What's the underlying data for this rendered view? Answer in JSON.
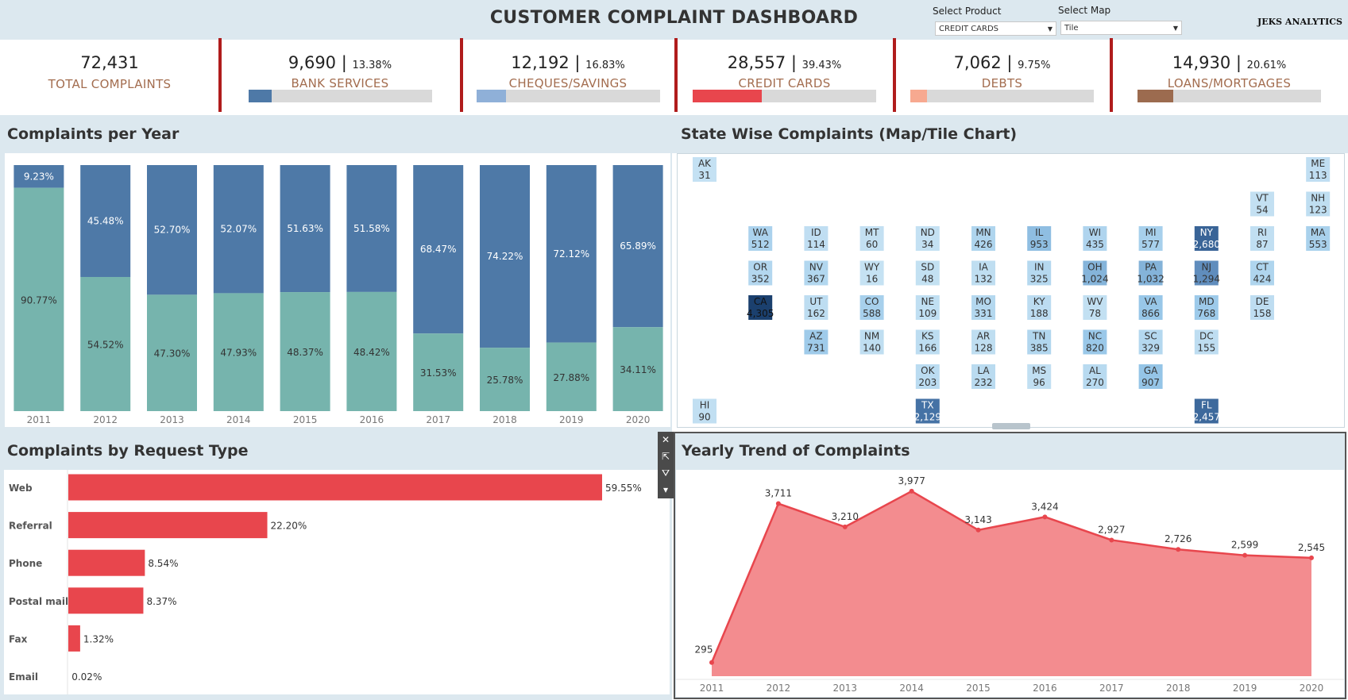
{
  "header": {
    "title": "CUSTOMER COMPLAINT DASHBOARD",
    "select_product_label": "Select Product",
    "select_product_value": "CREDIT CARDS",
    "select_map_label": "Select Map",
    "select_map_value": "Tile",
    "brand": "JEKS ANALYTICS"
  },
  "kpis": [
    {
      "value": "72,431",
      "pct": "",
      "label": "TOTAL COMPLAINTS",
      "share": null,
      "color": ""
    },
    {
      "value": "9,690",
      "pct": "13.38%",
      "label": "BANK SERVICES",
      "share": 0.1338,
      "color": "#4e79a7"
    },
    {
      "value": "12,192",
      "pct": "16.83%",
      "label": "CHEQUES/SAVINGS",
      "share": 0.1683,
      "color": "#8fb0d8"
    },
    {
      "value": "28,557",
      "pct": "39.43%",
      "label": "CREDIT CARDS",
      "share": 0.3943,
      "color": "#e8464d"
    },
    {
      "value": "7,062",
      "pct": "9.75%",
      "label": "DEBTS",
      "share": 0.0975,
      "color": "#f7a990"
    },
    {
      "value": "14,930",
      "pct": "20.61%",
      "label": "LOANS/MORTGAGES",
      "share": 0.2061,
      "color": "#9c6b4f"
    }
  ],
  "panels": {
    "per_year_title": "Complaints per Year",
    "state_title": "State Wise Complaints (Map/Tile Chart)",
    "request_title": "Complaints by Request Type",
    "trend_title": "Yearly Trend of Complaints"
  },
  "colors": {
    "top_series": "#4e79a7",
    "bottom_series": "#76b4ad",
    "accent_red": "#e8464d",
    "area_fill": "#f38c8f",
    "divider": "#b01c1c"
  },
  "toolbar_icons": [
    "close-icon",
    "popout-icon",
    "filter-icon",
    "dropdown-icon"
  ],
  "chart_data": [
    {
      "type": "bar",
      "subtype": "stacked-100",
      "categories": [
        "2011",
        "2012",
        "2013",
        "2014",
        "2015",
        "2016",
        "2017",
        "2018",
        "2019",
        "2020"
      ],
      "series": [
        {
          "values": [
            9.23,
            45.48,
            52.7,
            52.07,
            51.63,
            51.58,
            68.47,
            74.22,
            72.12,
            65.89
          ],
          "labels": [
            "9.23%",
            "45.48%",
            "52.70%",
            "52.07%",
            "51.63%",
            "51.58%",
            "68.47%",
            "74.22%",
            "72.12%",
            "65.89%"
          ]
        },
        {
          "values": [
            90.77,
            54.52,
            47.3,
            47.93,
            48.37,
            48.42,
            31.53,
            25.78,
            27.88,
            34.11
          ],
          "labels": [
            "90.77%",
            "54.52%",
            "47.30%",
            "47.93%",
            "48.37%",
            "48.42%",
            "31.53%",
            "25.78%",
            "27.88%",
            "34.11%"
          ]
        }
      ],
      "ylim": [
        0,
        100
      ]
    },
    {
      "type": "heatmap",
      "subtype": "tile-map",
      "tiles": [
        {
          "state": "AK",
          "value": 31,
          "label": "31",
          "col": 0,
          "row": 0
        },
        {
          "state": "ME",
          "value": 113,
          "label": "113",
          "col": 11,
          "row": 0
        },
        {
          "state": "VT",
          "value": 54,
          "label": "54",
          "col": 10,
          "row": 1
        },
        {
          "state": "NH",
          "value": 123,
          "label": "123",
          "col": 11,
          "row": 1
        },
        {
          "state": "WA",
          "value": 512,
          "label": "512",
          "col": 1,
          "row": 2
        },
        {
          "state": "ID",
          "value": 114,
          "label": "114",
          "col": 2,
          "row": 2
        },
        {
          "state": "MT",
          "value": 60,
          "label": "60",
          "col": 3,
          "row": 2
        },
        {
          "state": "ND",
          "value": 34,
          "label": "34",
          "col": 4,
          "row": 2
        },
        {
          "state": "MN",
          "value": 426,
          "label": "426",
          "col": 5,
          "row": 2
        },
        {
          "state": "IL",
          "value": 953,
          "label": "953",
          "col": 6,
          "row": 2
        },
        {
          "state": "WI",
          "value": 435,
          "label": "435",
          "col": 7,
          "row": 2
        },
        {
          "state": "MI",
          "value": 577,
          "label": "577",
          "col": 8,
          "row": 2
        },
        {
          "state": "NY",
          "value": 2680,
          "label": "2,680",
          "col": 9,
          "row": 2
        },
        {
          "state": "RI",
          "value": 87,
          "label": "87",
          "col": 10,
          "row": 2
        },
        {
          "state": "MA",
          "value": 553,
          "label": "553",
          "col": 11,
          "row": 2
        },
        {
          "state": "OR",
          "value": 352,
          "label": "352",
          "col": 1,
          "row": 3
        },
        {
          "state": "NV",
          "value": 367,
          "label": "367",
          "col": 2,
          "row": 3
        },
        {
          "state": "WY",
          "value": 16,
          "label": "16",
          "col": 3,
          "row": 3
        },
        {
          "state": "SD",
          "value": 48,
          "label": "48",
          "col": 4,
          "row": 3
        },
        {
          "state": "IA",
          "value": 132,
          "label": "132",
          "col": 5,
          "row": 3
        },
        {
          "state": "IN",
          "value": 325,
          "label": "325",
          "col": 6,
          "row": 3
        },
        {
          "state": "OH",
          "value": 1024,
          "label": "1,024",
          "col": 7,
          "row": 3
        },
        {
          "state": "PA",
          "value": 1032,
          "label": "1,032",
          "col": 8,
          "row": 3
        },
        {
          "state": "NJ",
          "value": 1294,
          "label": "1,294",
          "col": 9,
          "row": 3
        },
        {
          "state": "CT",
          "value": 424,
          "label": "424",
          "col": 10,
          "row": 3
        },
        {
          "state": "CA",
          "value": 4305,
          "label": "4,305",
          "col": 1,
          "row": 4
        },
        {
          "state": "UT",
          "value": 162,
          "label": "162",
          "col": 2,
          "row": 4
        },
        {
          "state": "CO",
          "value": 588,
          "label": "588",
          "col": 3,
          "row": 4
        },
        {
          "state": "NE",
          "value": 109,
          "label": "109",
          "col": 4,
          "row": 4
        },
        {
          "state": "MO",
          "value": 331,
          "label": "331",
          "col": 5,
          "row": 4
        },
        {
          "state": "KY",
          "value": 188,
          "label": "188",
          "col": 6,
          "row": 4
        },
        {
          "state": "WV",
          "value": 78,
          "label": "78",
          "col": 7,
          "row": 4
        },
        {
          "state": "VA",
          "value": 866,
          "label": "866",
          "col": 8,
          "row": 4
        },
        {
          "state": "MD",
          "value": 768,
          "label": "768",
          "col": 9,
          "row": 4
        },
        {
          "state": "DE",
          "value": 158,
          "label": "158",
          "col": 10,
          "row": 4
        },
        {
          "state": "AZ",
          "value": 731,
          "label": "731",
          "col": 2,
          "row": 5
        },
        {
          "state": "NM",
          "value": 140,
          "label": "140",
          "col": 3,
          "row": 5
        },
        {
          "state": "KS",
          "value": 166,
          "label": "166",
          "col": 4,
          "row": 5
        },
        {
          "state": "AR",
          "value": 128,
          "label": "128",
          "col": 5,
          "row": 5
        },
        {
          "state": "TN",
          "value": 385,
          "label": "385",
          "col": 6,
          "row": 5
        },
        {
          "state": "NC",
          "value": 820,
          "label": "820",
          "col": 7,
          "row": 5
        },
        {
          "state": "SC",
          "value": 329,
          "label": "329",
          "col": 8,
          "row": 5
        },
        {
          "state": "DC",
          "value": 155,
          "label": "155",
          "col": 9,
          "row": 5
        },
        {
          "state": "OK",
          "value": 203,
          "label": "203",
          "col": 4,
          "row": 6
        },
        {
          "state": "LA",
          "value": 232,
          "label": "232",
          "col": 5,
          "row": 6
        },
        {
          "state": "MS",
          "value": 96,
          "label": "96",
          "col": 6,
          "row": 6
        },
        {
          "state": "AL",
          "value": 270,
          "label": "270",
          "col": 7,
          "row": 6
        },
        {
          "state": "GA",
          "value": 907,
          "label": "907",
          "col": 8,
          "row": 6
        },
        {
          "state": "HI",
          "value": 90,
          "label": "90",
          "col": 0,
          "row": 7
        },
        {
          "state": "TX",
          "value": 2129,
          "label": "2,129",
          "col": 4,
          "row": 7
        },
        {
          "state": "FL",
          "value": 2457,
          "label": "2,457",
          "col": 9,
          "row": 7
        }
      ]
    },
    {
      "type": "bar",
      "orientation": "horizontal",
      "categories": [
        "Web",
        "Referral",
        "Phone",
        "Postal mail",
        "Fax",
        "Email"
      ],
      "values": [
        59.55,
        22.2,
        8.54,
        8.37,
        1.32,
        0.02
      ],
      "labels": [
        "59.55%",
        "22.20%",
        "8.54%",
        "8.37%",
        "1.32%",
        "0.02%"
      ],
      "xlim": [
        0,
        70
      ]
    },
    {
      "type": "area",
      "x": [
        "2011",
        "2012",
        "2013",
        "2014",
        "2015",
        "2016",
        "2017",
        "2018",
        "2019",
        "2020"
      ],
      "values": [
        295,
        3711,
        3210,
        3977,
        3143,
        3424,
        2927,
        2726,
        2599,
        2545
      ],
      "labels": [
        "295",
        "3,711",
        "3,210",
        "3,977",
        "3,143",
        "3,424",
        "2,927",
        "2,726",
        "2,599",
        "2,545"
      ],
      "ylim": [
        0,
        4300
      ]
    }
  ]
}
